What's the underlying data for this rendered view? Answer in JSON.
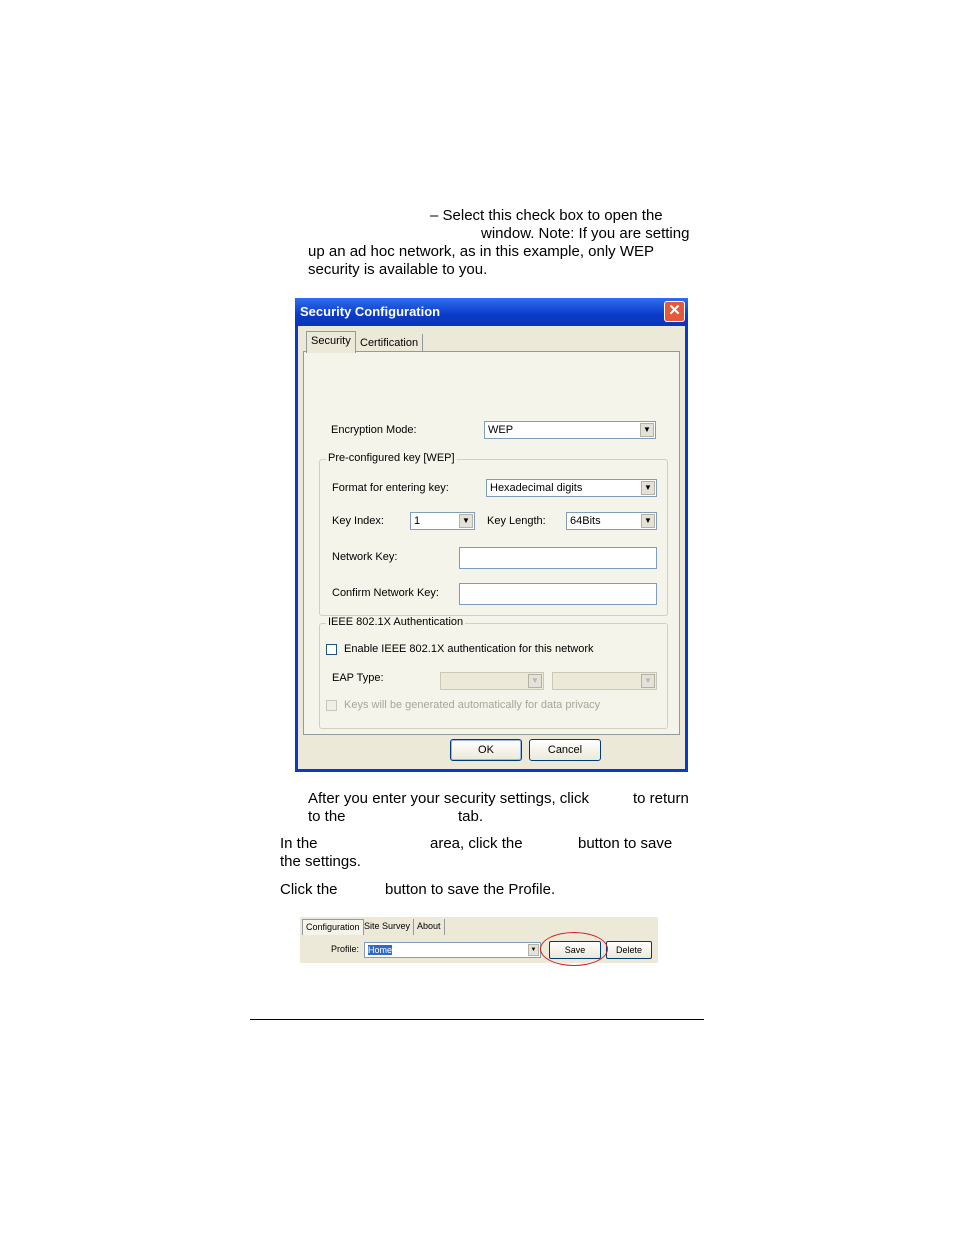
{
  "intro": {
    "line1": "– Select this check box to open the",
    "line2": "window. Note: If you are setting",
    "line3": "up an ad hoc network, as in this example, only WEP",
    "line4": "security is available to you."
  },
  "dialog": {
    "title": "Security Configuration",
    "close_glyph": "✕",
    "tabs": [
      "Security",
      "Certification"
    ],
    "encryption_mode_label": "Encryption Mode:",
    "encryption_mode_value": "WEP",
    "preconfigured_group": "Pre-configured key [WEP]",
    "format_label": "Format for entering key:",
    "format_value": "Hexadecimal digits",
    "key_index_label": "Key Index:",
    "key_index_value": "1",
    "key_length_label": "Key Length:",
    "key_length_value": "64Bits",
    "network_key_label": "Network Key:",
    "confirm_key_label": "Confirm Network Key:",
    "ieee_group": "IEEE 802.1X Authentication",
    "enable_ieee_label": "Enable IEEE 802.1X authentication for this network",
    "eap_type_label": "EAP Type:",
    "keys_auto_label": "Keys will be generated automatically for data privacy",
    "ok_label": "OK",
    "cancel_label": "Cancel",
    "dropdown_glyph": "▼"
  },
  "steps": {
    "after_line1": "After you enter your security settings, click",
    "after_line1b": "to return",
    "after_line2a": "to the",
    "after_line2b": "tab.",
    "inthe_a": "In the",
    "inthe_b": "area, click the",
    "inthe_c": "button to save",
    "inthe_line2": "the settings.",
    "click_a": "Click the",
    "click_b": "button to save the Profile."
  },
  "strip": {
    "tabs": [
      "Configuration",
      "Site Survey",
      "About"
    ],
    "profile_label": "Profile:",
    "profile_value": "Home",
    "save_label": "Save",
    "delete_label": "Delete",
    "dropdown_glyph": "▼"
  }
}
